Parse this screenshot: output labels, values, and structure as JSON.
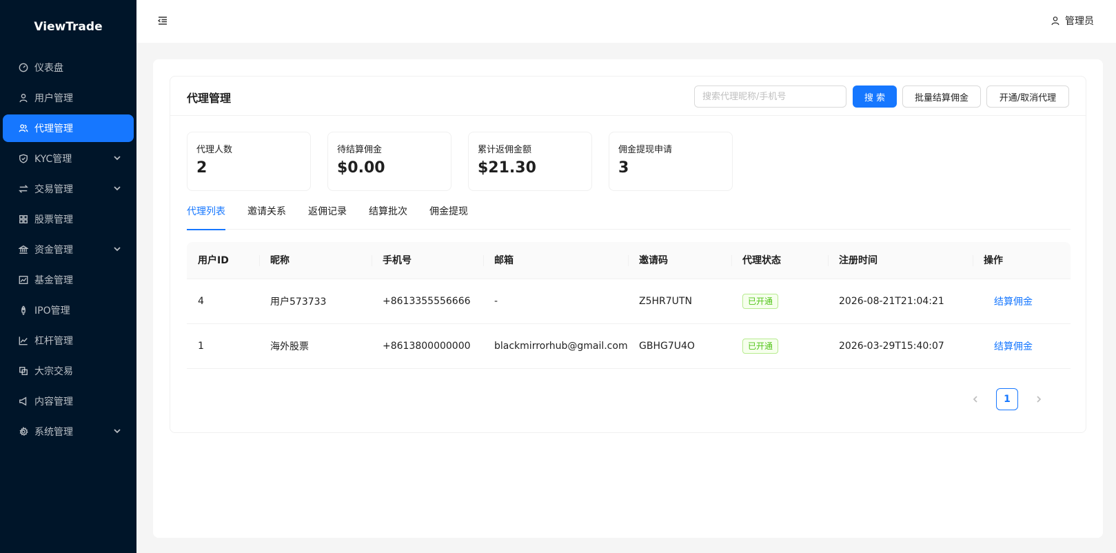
{
  "app": {
    "logo": "ViewTrade"
  },
  "sidebar": {
    "items": [
      {
        "label": "仪表盘",
        "icon": "dashboard-icon"
      },
      {
        "label": "用户管理",
        "icon": "user-icon"
      },
      {
        "label": "代理管理",
        "icon": "team-icon",
        "active": true
      },
      {
        "label": "KYC管理",
        "icon": "shield-icon",
        "expandable": true
      },
      {
        "label": "交易管理",
        "icon": "swap-icon",
        "expandable": true
      },
      {
        "label": "股票管理",
        "icon": "grid-icon"
      },
      {
        "label": "资金管理",
        "icon": "bank-icon",
        "expandable": true
      },
      {
        "label": "基金管理",
        "icon": "stock-chart-icon"
      },
      {
        "label": "IPO管理",
        "icon": "rocket-icon"
      },
      {
        "label": "杠杆管理",
        "icon": "line-chart-icon"
      },
      {
        "label": "大宗交易",
        "icon": "block-icon"
      },
      {
        "label": "内容管理",
        "icon": "notification-icon"
      },
      {
        "label": "系统管理",
        "icon": "setting-icon",
        "expandable": true
      }
    ]
  },
  "header": {
    "user_label": "管理员"
  },
  "page": {
    "title": "代理管理",
    "search_placeholder": "搜索代理昵称/手机号",
    "search_button": "搜 索",
    "batch_button": "批量结算佣金",
    "toggle_button": "开通/取消代理"
  },
  "stats": [
    {
      "label": "代理人数",
      "value": "2"
    },
    {
      "label": "待结算佣金",
      "value": "$0.00"
    },
    {
      "label": "累计返佣金额",
      "value": "$21.30"
    },
    {
      "label": "佣金提现申请",
      "value": "3"
    }
  ],
  "tabs": [
    "代理列表",
    "邀请关系",
    "返佣记录",
    "结算批次",
    "佣金提现"
  ],
  "table": {
    "columns": [
      "用户ID",
      "昵称",
      "手机号",
      "邮箱",
      "邀请码",
      "代理状态",
      "注册时间",
      "操作"
    ],
    "rows": [
      {
        "id": "4",
        "nickname": "用户573733",
        "phone": "+8613355556666",
        "email": "-",
        "code": "Z5HR7UTN",
        "status": "已开通",
        "time": "2026-08-21T21:04:21",
        "action": "结算佣金"
      },
      {
        "id": "1",
        "nickname": "海外股票",
        "phone": "+8613800000000",
        "email": "blackmirrorhub@gmail.com",
        "code": "GBHG7U4O",
        "status": "已开通",
        "time": "2026-03-29T15:40:07",
        "action": "结算佣金"
      }
    ]
  },
  "pagination": {
    "current": "1"
  },
  "colors": {
    "sidebar_bg": "#001529",
    "primary": "#1677ff",
    "success": "#52c41a"
  }
}
